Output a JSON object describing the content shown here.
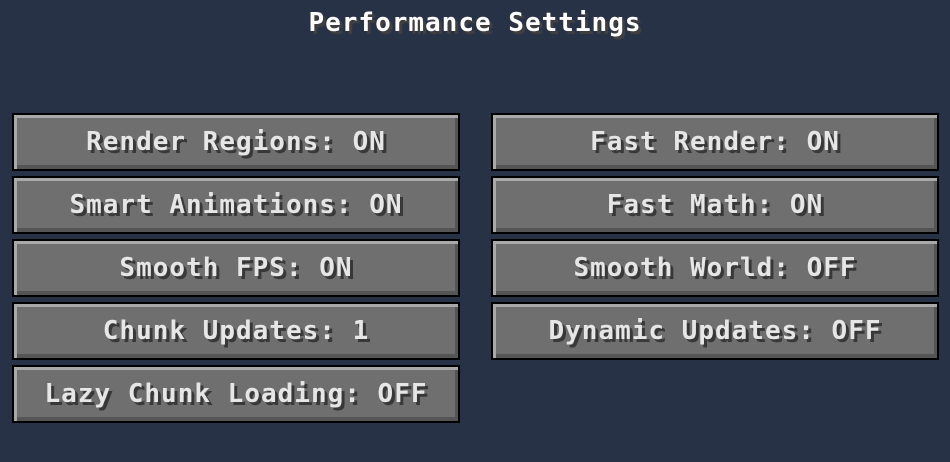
{
  "screen": {
    "title": "Performance Settings"
  },
  "left_column": {
    "render_regions": "Render Regions: ON",
    "smart_animations": "Smart Animations: ON",
    "smooth_fps": "Smooth FPS: ON",
    "chunk_updates": "Chunk Updates: 1",
    "lazy_chunk_loading": "Lazy Chunk Loading: OFF"
  },
  "right_column": {
    "fast_render": "Fast Render: ON",
    "fast_math": "Fast Math: ON",
    "smooth_world": "Smooth World: OFF",
    "dynamic_updates": "Dynamic Updates: OFF"
  },
  "colors": {
    "background": "#283246",
    "button_face": "#6f6f6f",
    "button_text": "#e6e6e6",
    "title_text": "#ffffff"
  }
}
